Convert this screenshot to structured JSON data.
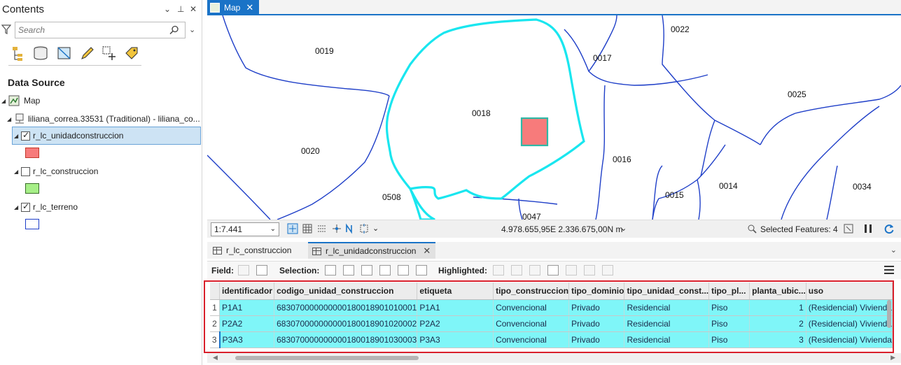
{
  "contents": {
    "title": "Contents",
    "search_placeholder": "Search",
    "section_title": "Data Source",
    "tree": {
      "map": "Map",
      "database": "liliana_correa.33531 (Traditional) - liliana_co...",
      "layers": [
        {
          "name": "r_lc_unidadconstruccion",
          "checked": true,
          "selected": true,
          "swatch": "#f77b7b"
        },
        {
          "name": "r_lc_construccion",
          "checked": false,
          "selected": false,
          "swatch": "#a6ef87"
        },
        {
          "name": "r_lc_terreno",
          "checked": true,
          "selected": false,
          "swatch": "#ffffff"
        }
      ]
    }
  },
  "map_view": {
    "tab_label": "Map",
    "parcel_labels": [
      "0019",
      "0022",
      "0017",
      "0025",
      "0018",
      "0020",
      "0016",
      "0015",
      "0014",
      "0034",
      "0508",
      "0047"
    ],
    "scale": "1:7.441",
    "coordinates": "4.978.655,95E 2.336.675,00N m",
    "selected_features": "Selected Features: 4"
  },
  "attribute_table": {
    "tabs": [
      {
        "label": "r_lc_construccion",
        "active": false
      },
      {
        "label": "r_lc_unidadconstruccion",
        "active": true
      }
    ],
    "toolbar": {
      "field_label": "Field:",
      "selection_label": "Selection:",
      "highlighted_label": "Highlighted:"
    },
    "columns": [
      "identificador",
      "codigo_unidad_construccion",
      "etiqueta",
      "tipo_construccion",
      "tipo_dominio",
      "tipo_unidad_const...",
      "tipo_pl...",
      "planta_ubic...",
      "uso"
    ],
    "rows": [
      {
        "n": "1",
        "cells": [
          "P1A1",
          "683070000000000180018901010001",
          "P1A1",
          "Convencional",
          "Privado",
          "Residencial",
          "Piso",
          "1",
          "(Residencial) Vivienda"
        ]
      },
      {
        "n": "2",
        "cells": [
          "P2A2",
          "683070000000000180018901020002",
          "P2A2",
          "Convencional",
          "Privado",
          "Residencial",
          "Piso",
          "2",
          "(Residencial) Vivienda"
        ]
      },
      {
        "n": "3",
        "cells": [
          "P3A3",
          "683070000000000180018901030003",
          "P3A3",
          "Convencional",
          "Privado",
          "Residencial",
          "Piso",
          "3",
          "(Residencial) Vivienda"
        ]
      }
    ]
  },
  "colors": {
    "accent": "#1a73c7",
    "selection_row": "#7ff6f8",
    "parcel_line": "#1f3fc8",
    "selected_outline": "#19e6ef",
    "highlight_box": "#d9202c"
  }
}
